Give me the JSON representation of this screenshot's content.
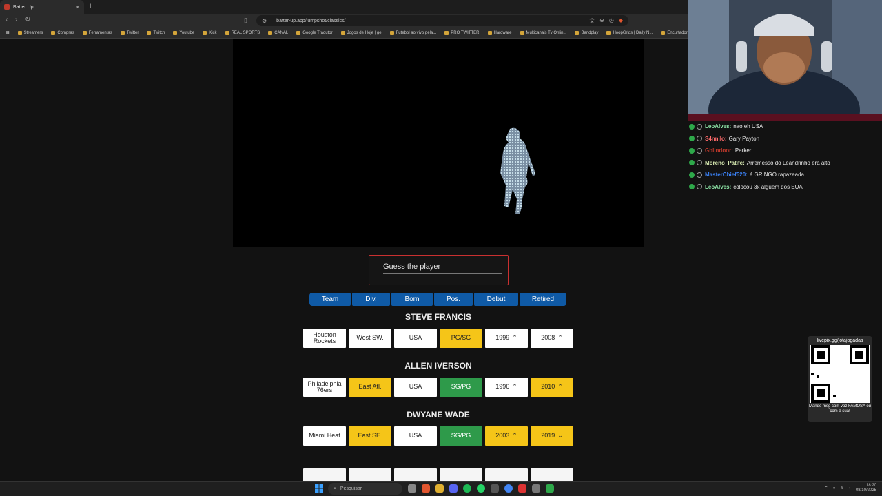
{
  "browser": {
    "tab_title": "Batter Up!",
    "url": "batter-up.app/jumpshot/classics/",
    "bookmarks": [
      "Streamers",
      "Compras",
      "Ferramentas",
      "Twitter",
      "Twitch",
      "Youtube",
      "Kick",
      "REAL SPORTS",
      "CANAL",
      "Google Tradutor",
      "Jogos de Hoje | ge",
      "Futebol ao vivo pela...",
      "PRO TWITTER",
      "Hardware",
      "Multicanais Tv Onlin...",
      "Bandplay",
      "HoopGrids | Daily N...",
      "Encurtador de Link..."
    ]
  },
  "game": {
    "guess_placeholder": "Guess the player",
    "filters": [
      "Team",
      "Div.",
      "Born",
      "Pos.",
      "Debut",
      "Retired"
    ],
    "guesses": [
      {
        "name": "STEVE FRANCIS",
        "cells": [
          {
            "text": "Houston Rockets",
            "status": "white",
            "arrow": ""
          },
          {
            "text": "West SW.",
            "status": "white",
            "arrow": ""
          },
          {
            "text": "USA",
            "status": "white",
            "arrow": ""
          },
          {
            "text": "PG/SG",
            "status": "yellow",
            "arrow": ""
          },
          {
            "text": "1999",
            "status": "white",
            "arrow": "up"
          },
          {
            "text": "2008",
            "status": "white",
            "arrow": "up"
          }
        ]
      },
      {
        "name": "ALLEN IVERSON",
        "cells": [
          {
            "text": "Philadelphia 76ers",
            "status": "white",
            "arrow": ""
          },
          {
            "text": "East Atl.",
            "status": "yellow",
            "arrow": ""
          },
          {
            "text": "USA",
            "status": "white",
            "arrow": ""
          },
          {
            "text": "SG/PG",
            "status": "green",
            "arrow": ""
          },
          {
            "text": "1996",
            "status": "white",
            "arrow": "up"
          },
          {
            "text": "2010",
            "status": "yellow",
            "arrow": "up"
          }
        ]
      },
      {
        "name": "DWYANE WADE",
        "cells": [
          {
            "text": "Miami Heat",
            "status": "white",
            "arrow": ""
          },
          {
            "text": "East SE.",
            "status": "yellow",
            "arrow": ""
          },
          {
            "text": "USA",
            "status": "white",
            "arrow": ""
          },
          {
            "text": "SG/PG",
            "status": "green",
            "arrow": ""
          },
          {
            "text": "2003",
            "status": "yellow",
            "arrow": "up"
          },
          {
            "text": "2019",
            "status": "yellow",
            "arrow": "down"
          }
        ]
      }
    ]
  },
  "chat": {
    "messages": [
      {
        "user": "LeoAlves:",
        "text": "nao eh USA",
        "color": "#8fe6a8"
      },
      {
        "user": "S4nnilo:",
        "text": "Gary Payton",
        "color": "#ff6b6b"
      },
      {
        "user": "Gblindoor:",
        "text": "Parker",
        "color": "#c0392b"
      },
      {
        "user": "Moreno_Patife:",
        "text": "Arremesso do Leandrinho era alto",
        "color": "#d6e8b0"
      },
      {
        "user": "MasterChief520:",
        "text": "é GRINGO rapazeada",
        "color": "#3b82f6"
      },
      {
        "user": "LeoAlves:",
        "text": "colocou 3x alguem dos EUA",
        "color": "#8fe6a8"
      }
    ]
  },
  "qr": {
    "top": "livepix.gg/jotajogadas",
    "bottom": "Mande msg com voz FAMOSA ou com a sua!"
  },
  "taskbar": {
    "search_placeholder": "Pesquisar",
    "time": "18:20",
    "date": "08/10/2025"
  },
  "colors": {
    "filter_blue": "#0f5aa6",
    "correct_green": "#2e9a4a",
    "partial_yellow": "#f5c518",
    "guess_border": "#c93030"
  },
  "icons": {
    "arrow_up": "⌃",
    "arrow_down": "⌄"
  }
}
